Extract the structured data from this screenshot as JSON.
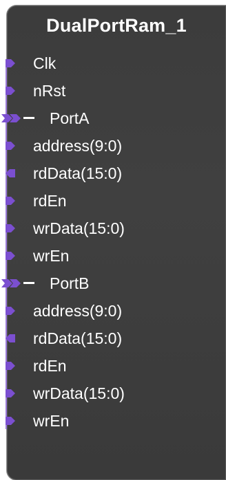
{
  "block": {
    "title": "DualPortRam_1",
    "ports": [
      {
        "id": "clk",
        "label": "Clk",
        "dir": "in",
        "group": false
      },
      {
        "id": "nrst",
        "label": "nRst",
        "dir": "in",
        "group": false
      },
      {
        "id": "porta",
        "label": "PortA",
        "dir": "bus",
        "group": true
      },
      {
        "id": "porta-address",
        "label": "address(9:0)",
        "dir": "in",
        "group": false
      },
      {
        "id": "porta-rddata",
        "label": "rdData(15:0)",
        "dir": "out",
        "group": false
      },
      {
        "id": "porta-rden",
        "label": "rdEn",
        "dir": "in",
        "group": false
      },
      {
        "id": "porta-wrdata",
        "label": "wrData(15:0)",
        "dir": "in",
        "group": false
      },
      {
        "id": "porta-wren",
        "label": "wrEn",
        "dir": "in",
        "group": false
      },
      {
        "id": "portb",
        "label": "PortB",
        "dir": "bus",
        "group": true
      },
      {
        "id": "portb-address",
        "label": "address(9:0)",
        "dir": "in",
        "group": false
      },
      {
        "id": "portb-rddata",
        "label": "rdData(15:0)",
        "dir": "out",
        "group": false
      },
      {
        "id": "portb-rden",
        "label": "rdEn",
        "dir": "in",
        "group": false
      },
      {
        "id": "portb-wrdata",
        "label": "wrData(15:0)",
        "dir": "in",
        "group": false
      },
      {
        "id": "portb-wren",
        "label": "wrEn",
        "dir": "in",
        "group": false
      }
    ]
  },
  "colors": {
    "block_fill": "#3d3d3d",
    "port_marker": "#7b4fd0",
    "text": "#ffffff"
  }
}
